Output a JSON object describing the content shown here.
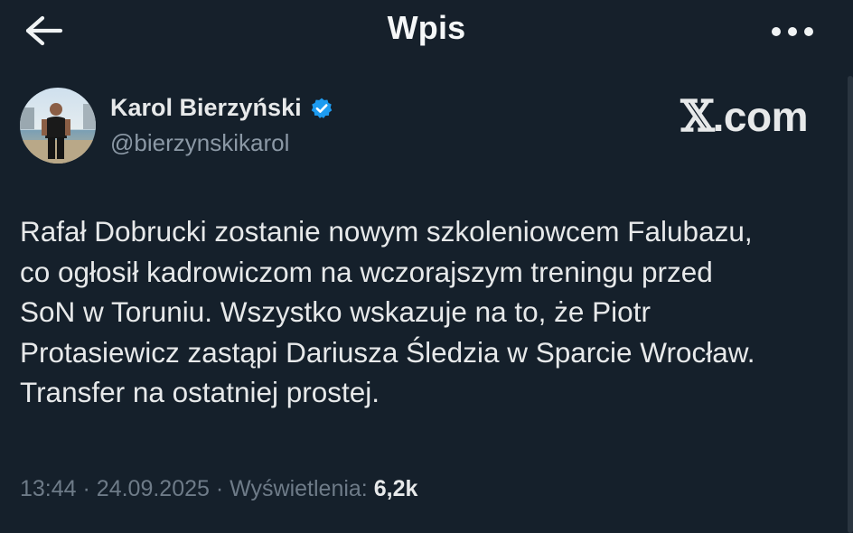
{
  "header": {
    "title": "Wpis",
    "back_icon": "arrow-left-icon",
    "more_icon": "more-horizontal-icon"
  },
  "author": {
    "name": "Karol Bierzyński",
    "handle": "@bierzynskikarol",
    "verified_icon": "verified-badge-icon",
    "verified_color": "#1d9bf0"
  },
  "brand": {
    "x": "𝕏",
    "suffix": ".com"
  },
  "tweet": {
    "text": "Rafał Dobrucki zostanie nowym szkoleniowcem Falubazu,\nco ogłosił kadrowiczom na wczorajszym treningu przed\nSoN w Toruniu. Wszystko wskazuje na to, że Piotr\nProtasiewicz zastąpi Dariusza Śledzia w Sparcie Wrocław.\nTransfer na ostatniej prostej."
  },
  "meta": {
    "time": "13:44",
    "date": "24.09.2025",
    "views_label": "Wyświetlenia:",
    "views_count": "6,2k",
    "separator": "·"
  },
  "colors": {
    "background": "#15202b",
    "text": "#e7e9ea",
    "secondary_text": "#8b98a5",
    "accent": "#1d9bf0"
  }
}
